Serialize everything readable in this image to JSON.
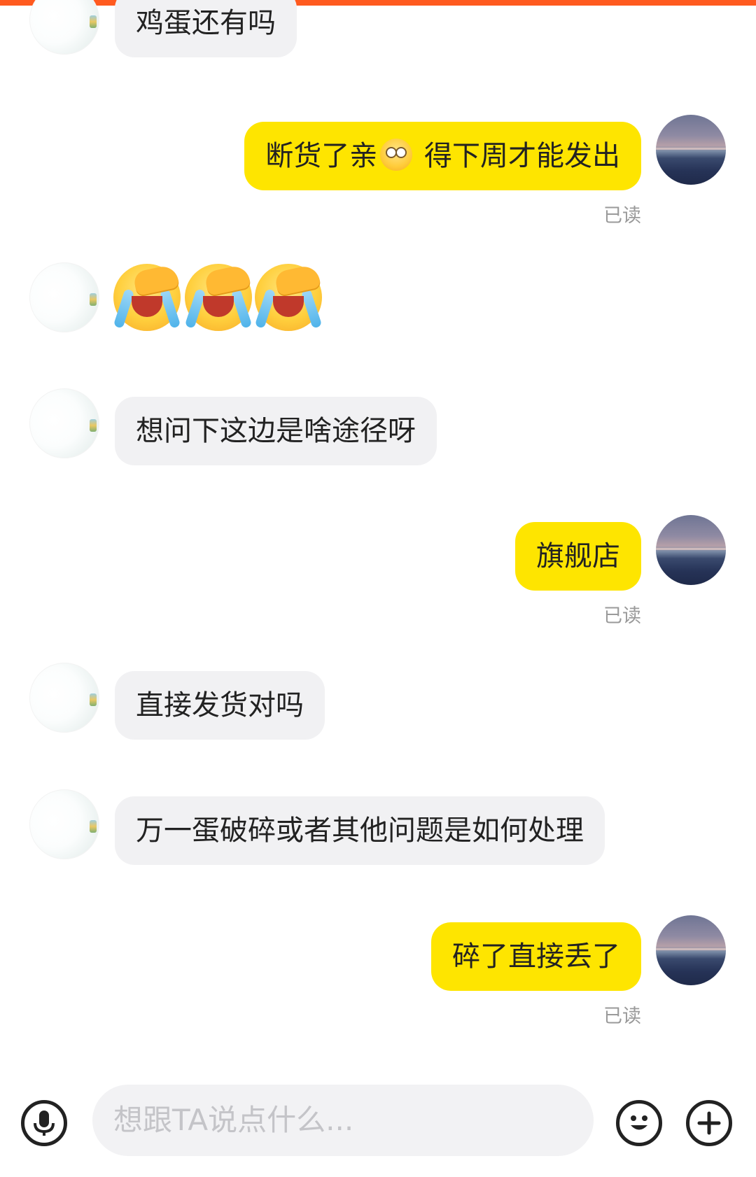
{
  "messages": [
    {
      "from": "them",
      "text": "鸡蛋还有吗"
    },
    {
      "from": "me",
      "text_before": "断货了亲",
      "inline_emoji": "pleading-face-emoji",
      "text_after": " 得下周才能发出",
      "status": "已读"
    },
    {
      "from": "them",
      "emojis": [
        "loudly-crying-face-emoji",
        "loudly-crying-face-emoji",
        "loudly-crying-face-emoji"
      ]
    },
    {
      "from": "them",
      "text": "想问下这边是啥途径呀"
    },
    {
      "from": "me",
      "text": "旗舰店",
      "status": "已读"
    },
    {
      "from": "them",
      "text": "直接发货对吗"
    },
    {
      "from": "them",
      "text": "万一蛋破碎或者其他问题是如何处理"
    },
    {
      "from": "me",
      "text": "碎了直接丢了",
      "status": "已读"
    }
  ],
  "input": {
    "placeholder": "想跟TA说点什么...",
    "value": ""
  },
  "icons": {
    "voice": "microphone-icon",
    "emoji": "smiley-face-icon",
    "more": "plus-icon"
  },
  "colors": {
    "my_bubble": "#fee500",
    "their_bubble": "#f1f1f3",
    "top_bar": "#ff5a1f"
  }
}
